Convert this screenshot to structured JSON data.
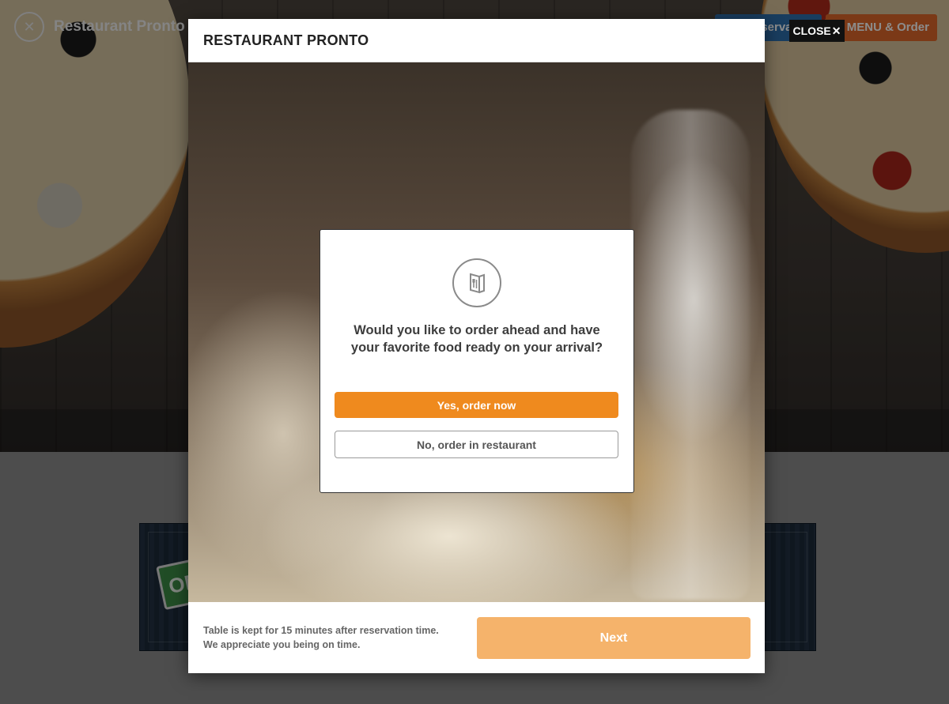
{
  "background": {
    "brand_name": "Restaurant Pronto",
    "nav": {
      "reserve_label": "Reservation",
      "menu_label": "See MENU & Order"
    },
    "sign_text": "OPEN"
  },
  "close_button": {
    "label": "CLOSE",
    "icon": "close-icon"
  },
  "modal": {
    "title": "RESTAURANT PRONTO",
    "dialog": {
      "icon": "menu-book-icon",
      "question": "Would you like to order ahead and have your favorite food ready on your arrival?",
      "yes_label": "Yes, order now",
      "no_label": "No, order in restaurant"
    },
    "footer": {
      "note_line1": "Table is kept for 15 minutes after reservation time.",
      "note_line2": "We appreciate you being on time.",
      "next_label": "Next"
    }
  },
  "colors": {
    "accent_orange": "#ef8a1e",
    "next_disabled": "#f5b36b",
    "reserve_blue": "#2f6fae",
    "menu_orange": "#e0692a"
  }
}
